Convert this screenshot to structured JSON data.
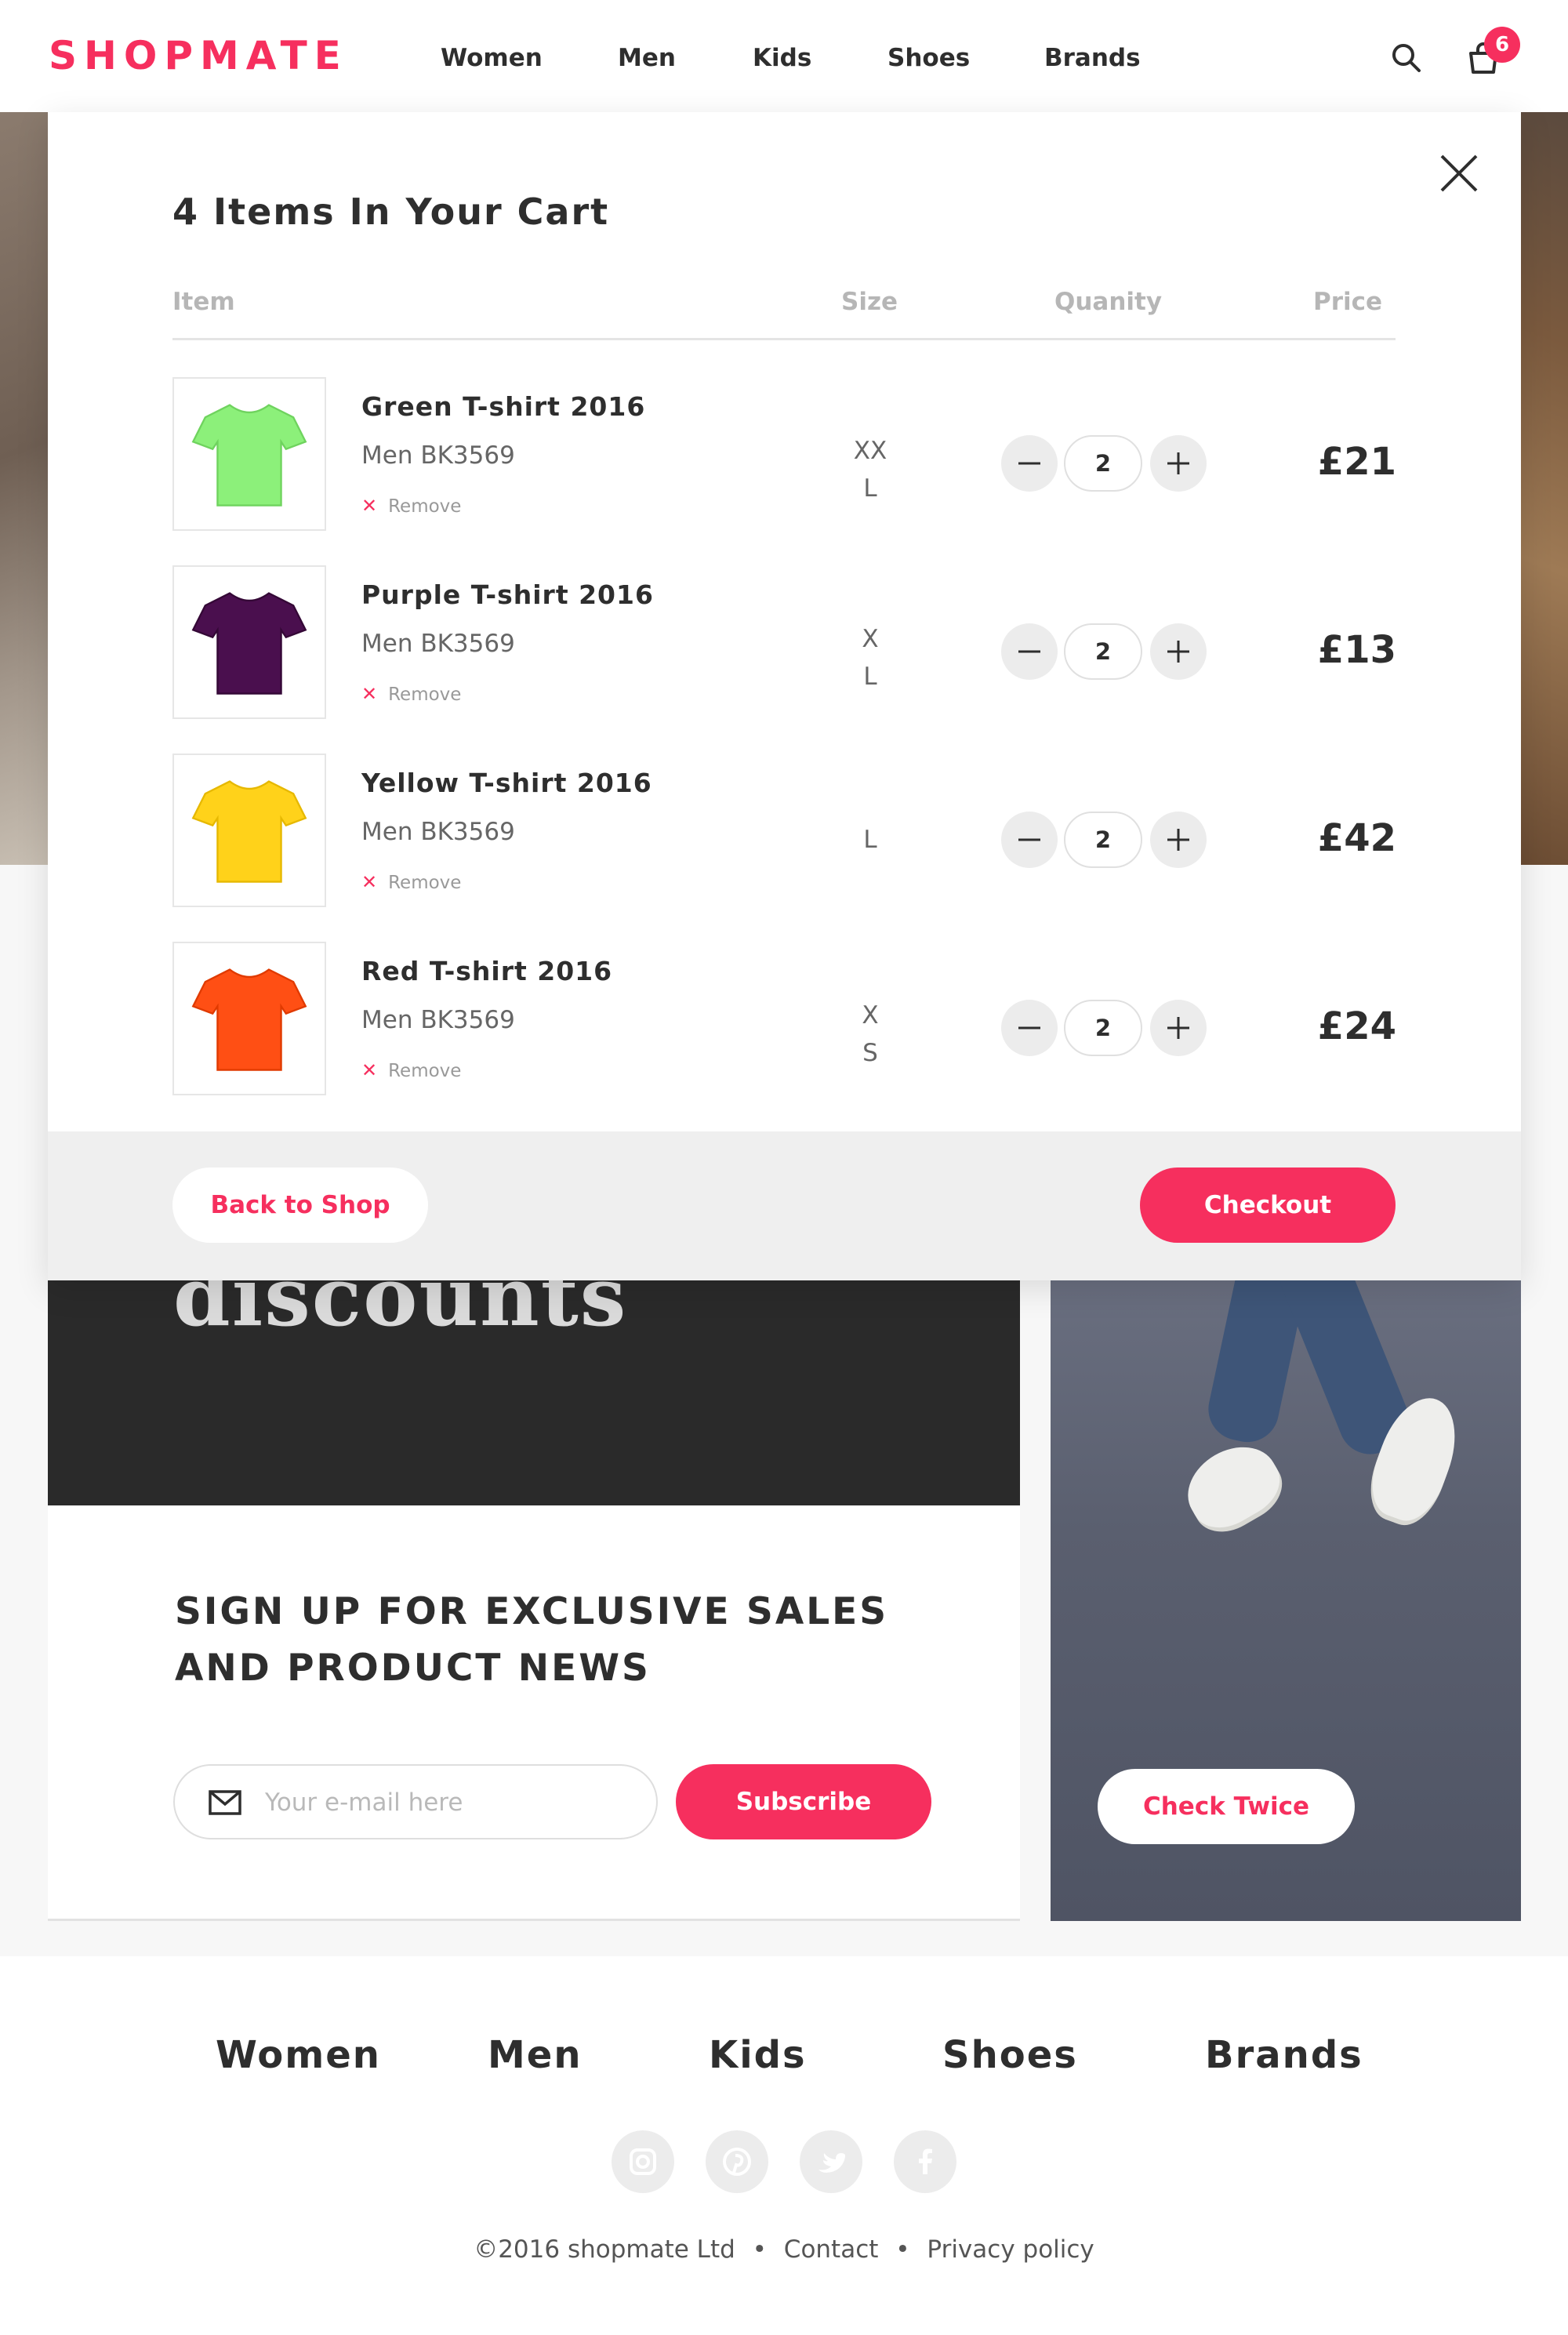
{
  "brand": {
    "name": "SHOPMATE",
    "accent_color": "#f62f5e"
  },
  "nav": {
    "items": [
      "Women",
      "Men",
      "Kids",
      "Shoes",
      "Brands"
    ]
  },
  "header": {
    "search_icon": "search-icon",
    "cart_icon": "shopping-bag-icon",
    "cart_count": "6"
  },
  "cart": {
    "title": "4 Items In Your Cart",
    "columns": {
      "item": "Item",
      "size": "Size",
      "quantity": "Quanity",
      "price": "Price"
    },
    "remove_label": "Remove",
    "items": [
      {
        "name": "Green T-shirt 2016",
        "sku": "Men BK3569",
        "size": "XX\nL",
        "qty": "2",
        "price": "£21",
        "color": "#8cf07a"
      },
      {
        "name": "Purple T-shirt 2016",
        "sku": "Men BK3569",
        "size": "X\nL",
        "qty": "2",
        "price": "£13",
        "color": "#4a0f4e"
      },
      {
        "name": "Yellow T-shirt 2016",
        "sku": "Men BK3569",
        "size": "L",
        "qty": "2",
        "price": "£42",
        "color": "#ffd21a"
      },
      {
        "name": "Red T-shirt 2016",
        "sku": "Men BK3569",
        "size": "X\nS",
        "qty": "2",
        "price": "£24",
        "color": "#ff4f14"
      }
    ],
    "back_label": "Back to Shop",
    "checkout_label": "Checkout"
  },
  "promo": {
    "text": "discounts"
  },
  "signup": {
    "heading_line1": "SIGN UP FOR EXCLUSIVE SALES",
    "heading_line2": "AND PRODUCT NEWS",
    "email_placeholder": "Your e-mail here",
    "subscribe_label": "Subscribe"
  },
  "feature": {
    "button_label": "Check Twice"
  },
  "footer": {
    "nav": [
      "Women",
      "Men",
      "Kids",
      "Shoes",
      "Brands"
    ],
    "social_icons": [
      "instagram-icon",
      "pinterest-icon",
      "twitter-icon",
      "facebook-icon"
    ],
    "copyright": "©2016 shopmate Ltd",
    "links": [
      "Contact",
      "Privacy policy"
    ]
  }
}
